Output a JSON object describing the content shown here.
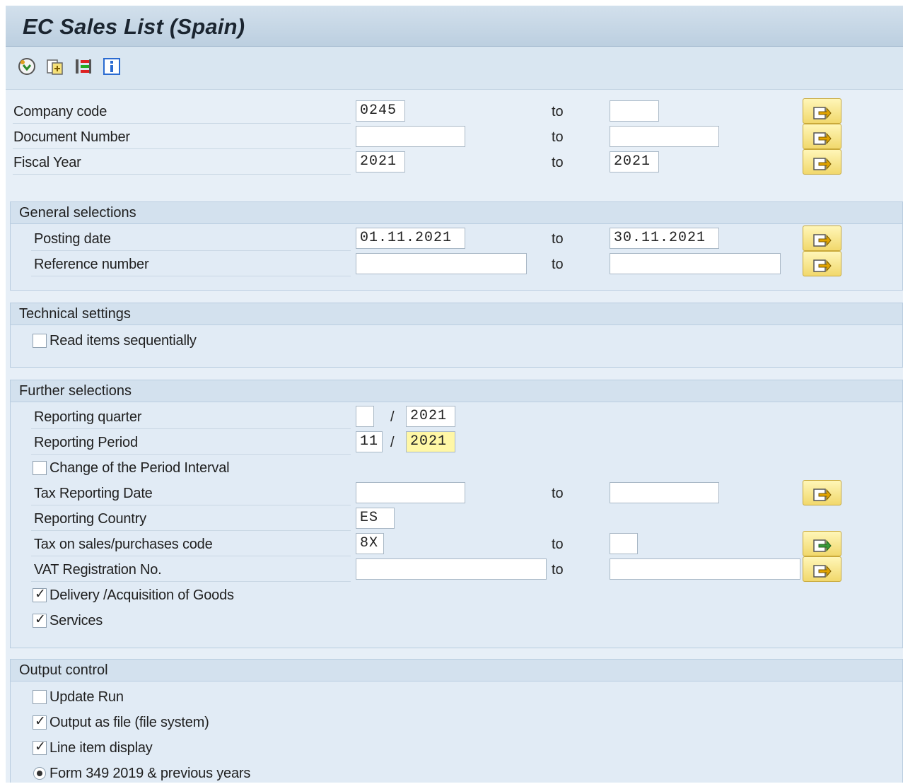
{
  "title": "EC Sales List (Spain)",
  "toolbar": {
    "items": [
      {
        "name": "execute-icon"
      },
      {
        "name": "variant-icon"
      },
      {
        "name": "selection-options-icon"
      },
      {
        "name": "info-icon"
      }
    ]
  },
  "top_fields": [
    {
      "label": "Company code",
      "from": "0245",
      "to_label": "to",
      "to": ""
    },
    {
      "label": "Document Number",
      "from": "",
      "to_label": "to",
      "to": ""
    },
    {
      "label": "Fiscal Year",
      "from": "2021",
      "to_label": "to",
      "to": "2021"
    }
  ],
  "general": {
    "title": "General selections",
    "fields": [
      {
        "label": "Posting date",
        "from": "01.11.2021",
        "to_label": "to",
        "to": "30.11.2021"
      },
      {
        "label": "Reference number",
        "from": "",
        "to_label": "to",
        "to": ""
      }
    ]
  },
  "technical": {
    "title": "Technical settings",
    "read_sequential": {
      "label": "Read items sequentially",
      "checked": false
    }
  },
  "further": {
    "title": "Further selections",
    "reporting_quarter": {
      "label": "Reporting quarter",
      "q": "",
      "sep": "/",
      "year": "2021"
    },
    "reporting_period": {
      "label": "Reporting Period",
      "p": "11",
      "sep": "/",
      "year": "2021"
    },
    "change_interval": {
      "label": "Change of the Period Interval",
      "checked": false
    },
    "tax_reporting_date": {
      "label": "Tax Reporting Date",
      "from": "",
      "to_label": "to",
      "to": ""
    },
    "reporting_country": {
      "label": "Reporting Country",
      "value": "ES"
    },
    "tax_code": {
      "label": "Tax on sales/purchases code",
      "from": "8X",
      "to_label": "to",
      "to": ""
    },
    "vat_reg": {
      "label": "VAT Registration No.",
      "from": "",
      "to_label": "to",
      "to": ""
    },
    "delivery": {
      "label": "Delivery /Acquisition of Goods",
      "checked": true
    },
    "services": {
      "label": "Services",
      "checked": true
    }
  },
  "output": {
    "title": "Output control",
    "update_run": {
      "label": "Update Run",
      "checked": false
    },
    "output_file": {
      "label": "Output as file (file system)",
      "checked": true
    },
    "line_item": {
      "label": "Line item display",
      "checked": true
    },
    "form349": {
      "label": "Form 349 2019 & previous years",
      "selected": true
    }
  },
  "colors": {
    "highlight": "#fff7a6",
    "accent": "#f1d86c"
  }
}
